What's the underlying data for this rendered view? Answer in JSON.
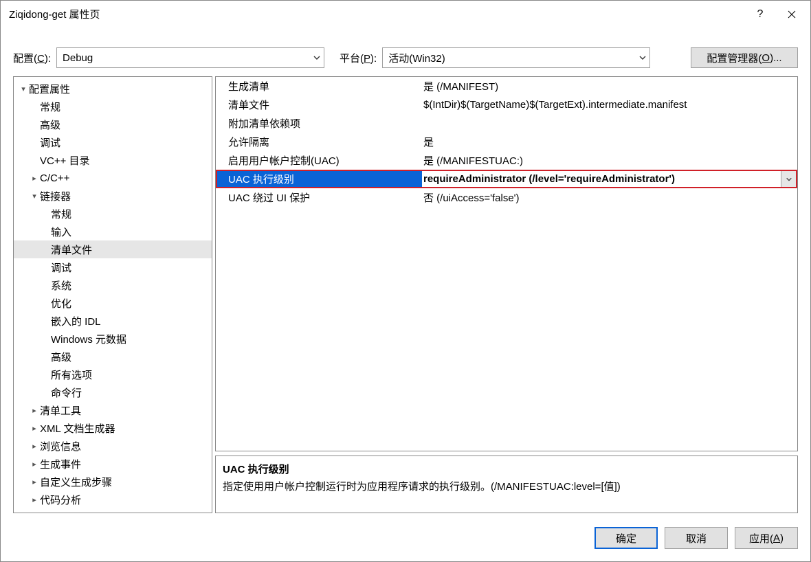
{
  "window": {
    "title": "Ziqidong-get 属性页",
    "help_icon": "?",
    "close_icon": "close"
  },
  "configRow": {
    "configLabelPrefix": "配置(",
    "configLabelKey": "C",
    "configLabelSuffix": "):",
    "configValue": "Debug",
    "platformLabelPrefix": "平台(",
    "platformLabelKey": "P",
    "platformLabelSuffix": "):",
    "platformValue": "活动(Win32)",
    "managerBtnPrefix": "配置管理器(",
    "managerBtnKey": "O",
    "managerBtnSuffix": ")..."
  },
  "tree": [
    {
      "label": "配置属性",
      "indent": 0,
      "glyph": "▾"
    },
    {
      "label": "常规",
      "indent": 1,
      "glyph": ""
    },
    {
      "label": "高级",
      "indent": 1,
      "glyph": ""
    },
    {
      "label": "调试",
      "indent": 1,
      "glyph": ""
    },
    {
      "label": "VC++ 目录",
      "indent": 1,
      "glyph": ""
    },
    {
      "label": "C/C++",
      "indent": 1,
      "glyph": "▸"
    },
    {
      "label": "链接器",
      "indent": 1,
      "glyph": "▾"
    },
    {
      "label": "常规",
      "indent": 2,
      "glyph": ""
    },
    {
      "label": "输入",
      "indent": 2,
      "glyph": ""
    },
    {
      "label": "清单文件",
      "indent": 2,
      "glyph": "",
      "selected": true
    },
    {
      "label": "调试",
      "indent": 2,
      "glyph": ""
    },
    {
      "label": "系统",
      "indent": 2,
      "glyph": ""
    },
    {
      "label": "优化",
      "indent": 2,
      "glyph": ""
    },
    {
      "label": "嵌入的 IDL",
      "indent": 2,
      "glyph": ""
    },
    {
      "label": "Windows 元数据",
      "indent": 2,
      "glyph": ""
    },
    {
      "label": "高级",
      "indent": 2,
      "glyph": ""
    },
    {
      "label": "所有选项",
      "indent": 2,
      "glyph": ""
    },
    {
      "label": "命令行",
      "indent": 2,
      "glyph": ""
    },
    {
      "label": "清单工具",
      "indent": 1,
      "glyph": "▸"
    },
    {
      "label": "XML 文档生成器",
      "indent": 1,
      "glyph": "▸"
    },
    {
      "label": "浏览信息",
      "indent": 1,
      "glyph": "▸"
    },
    {
      "label": "生成事件",
      "indent": 1,
      "glyph": "▸"
    },
    {
      "label": "自定义生成步骤",
      "indent": 1,
      "glyph": "▸"
    },
    {
      "label": "代码分析",
      "indent": 1,
      "glyph": "▸"
    }
  ],
  "grid": [
    {
      "name": "生成清单",
      "value": "是 (/MANIFEST)"
    },
    {
      "name": "清单文件",
      "value": "$(IntDir)$(TargetName)$(TargetExt).intermediate.manifest"
    },
    {
      "name": "附加清单依赖项",
      "value": ""
    },
    {
      "name": "允许隔离",
      "value": "是"
    },
    {
      "name": "启用用户帐户控制(UAC)",
      "value": "是 (/MANIFESTUAC:)"
    },
    {
      "name": "UAC 执行级别",
      "value": "requireAdministrator (/level='requireAdministrator')",
      "selected": true,
      "hasDropdown": true
    },
    {
      "name": "UAC 绕过 UI 保护",
      "value": "否 (/uiAccess='false')"
    }
  ],
  "description": {
    "title": "UAC 执行级别",
    "text": "指定使用用户帐户控制运行时为应用程序请求的执行级别。(/MANIFESTUAC:level=[值])"
  },
  "footer": {
    "ok": "确定",
    "cancel": "取消",
    "applyPrefix": "应用(",
    "applyKey": "A",
    "applySuffix": ")"
  }
}
